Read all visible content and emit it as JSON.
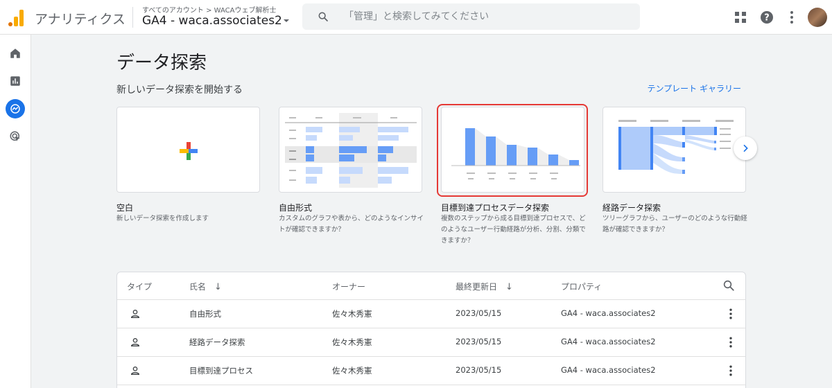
{
  "header": {
    "app_title": "アナリティクス",
    "breadcrumb": "すべてのアカウント > WACAウェブ解析士",
    "property": "GA4 - waca.associates2",
    "search_placeholder": "「管理」と検索してみてください"
  },
  "main": {
    "title": "データ探索",
    "subtitle": "新しいデータ探索を開始する",
    "gallery_link": "テンプレート ギャラリー"
  },
  "cards": [
    {
      "title": "空白",
      "desc": "新しいデータ探索を作成します"
    },
    {
      "title": "自由形式",
      "desc": "カスタムのグラフや表から、どのようなインサイトが確認できますか？"
    },
    {
      "title": "目標到達プロセスデータ探索",
      "desc": "複数のステップから成る目標到達プロセスで、どのようなユーザー行動経路が分析、分割、分類できますか？"
    },
    {
      "title": "経路データ探索",
      "desc": "ツリーグラフから、ユーザーのどのような行動経路が確認できますか？"
    }
  ],
  "table": {
    "headers": {
      "type": "タイプ",
      "name": "氏名",
      "owner": "オーナー",
      "updated": "最終更新日",
      "property": "プロパティ"
    },
    "rows": [
      {
        "name": "自由形式",
        "owner": "佐々木秀憲",
        "updated": "2023/05/15",
        "property": "GA4 - waca.associates2"
      },
      {
        "name": "経路データ探索",
        "owner": "佐々木秀憲",
        "updated": "2023/05/15",
        "property": "GA4 - waca.associates2"
      },
      {
        "name": "目標到達プロセス",
        "owner": "佐々木秀憲",
        "updated": "2023/05/15",
        "property": "GA4 - waca.associates2"
      }
    ]
  },
  "colors": {
    "accent": "#1a73e8",
    "highlight": "#e53935"
  }
}
